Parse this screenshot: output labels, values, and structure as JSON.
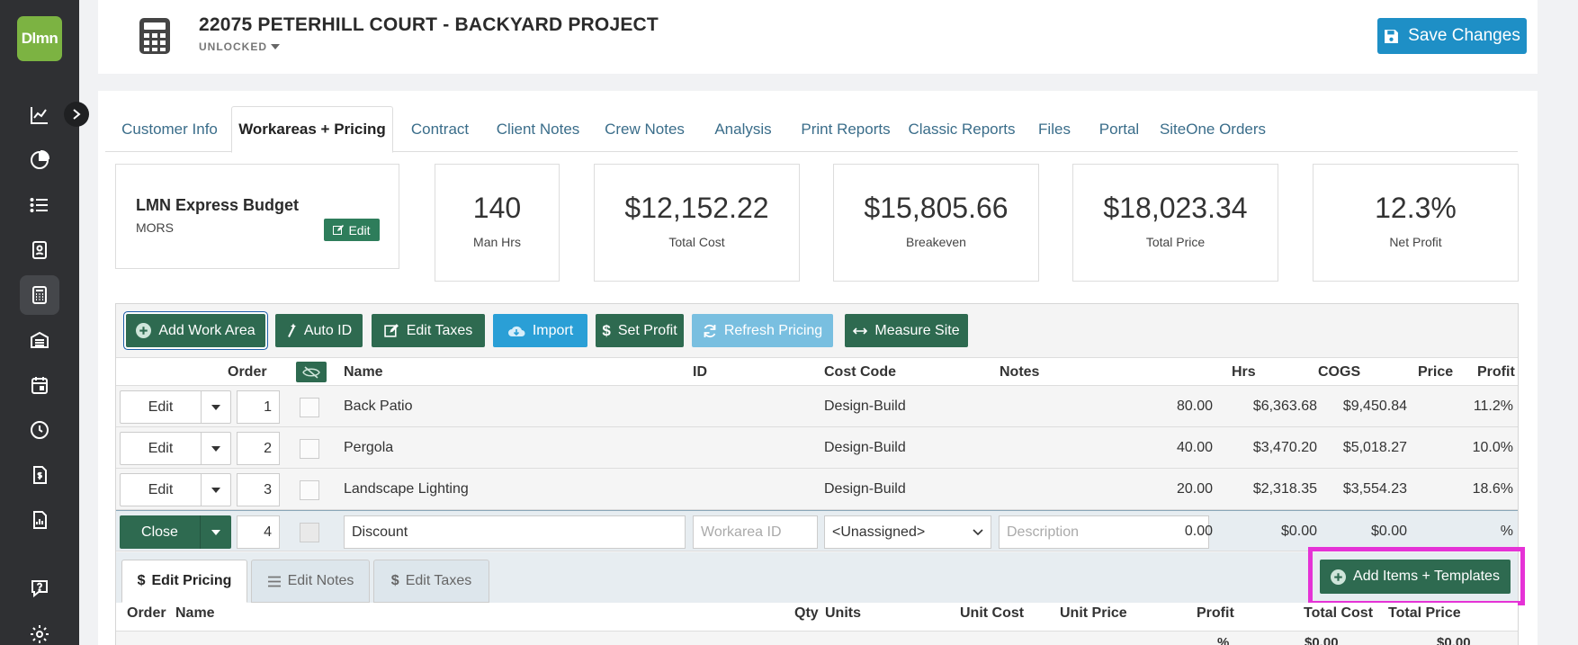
{
  "app": {
    "logo_text": "Dlmn"
  },
  "header": {
    "title": "22075 PETERHILL COURT - BACKYARD PROJECT",
    "lock_status": "UNLOCKED",
    "save_label": "Save Changes"
  },
  "tabs": [
    "Customer Info",
    "Workareas + Pricing",
    "Contract",
    "Client Notes",
    "Crew Notes",
    "Analysis",
    "Print Reports",
    "Classic Reports",
    "Files",
    "Portal",
    "SiteOne Orders"
  ],
  "budget": {
    "title": "LMN Express Budget",
    "subtitle": "MORS",
    "edit_label": "Edit"
  },
  "stats": [
    {
      "value": "140",
      "label": "Man Hrs"
    },
    {
      "value": "$12,152.22",
      "label": "Total Cost"
    },
    {
      "value": "$15,805.66",
      "label": "Breakeven"
    },
    {
      "value": "$18,023.34",
      "label": "Total Price"
    },
    {
      "value": "12.3%",
      "label": "Net Profit"
    }
  ],
  "toolbar": {
    "add_work_area": "Add Work Area",
    "auto_id": "Auto ID",
    "edit_taxes": "Edit Taxes",
    "import": "Import",
    "set_profit": "Set Profit",
    "refresh_pricing": "Refresh Pricing",
    "measure_site": "Measure Site"
  },
  "table": {
    "headers": {
      "order": "Order",
      "name": "Name",
      "id": "ID",
      "cost_code": "Cost Code",
      "notes": "Notes",
      "hrs": "Hrs",
      "cogs": "COGS",
      "price": "Price",
      "profit": "Profit"
    },
    "edit_label": "Edit",
    "close_label": "Close",
    "rows": [
      {
        "order": "1",
        "name": "Back Patio",
        "cost_code": "Design-Build",
        "hrs": "80.00",
        "cogs": "$6,363.68",
        "price": "$9,450.84",
        "profit": "11.2%"
      },
      {
        "order": "2",
        "name": "Pergola",
        "cost_code": "Design-Build",
        "hrs": "40.00",
        "cogs": "$3,470.20",
        "price": "$5,018.27",
        "profit": "10.0%"
      },
      {
        "order": "3",
        "name": "Landscape Lighting",
        "cost_code": "Design-Build",
        "hrs": "20.00",
        "cogs": "$2,318.35",
        "price": "$3,554.23",
        "profit": "18.6%"
      }
    ],
    "open_row": {
      "order": "4",
      "name_value": "Discount",
      "id_placeholder": "Workarea ID",
      "cost_code_value": "<Unassigned>",
      "notes_placeholder": "Description",
      "hrs": "0.00",
      "cogs": "$0.00",
      "price": "$0.00",
      "profit": "%"
    }
  },
  "subtabs": [
    "Edit Pricing",
    "Edit Notes",
    "Edit Taxes"
  ],
  "add_items_label": "Add Items + Templates",
  "sub_table": {
    "headers": {
      "order": "Order",
      "name": "Name",
      "qty": "Qty",
      "units": "Units",
      "unit_cost": "Unit Cost",
      "unit_price": "Unit Price",
      "profit": "Profit",
      "total_cost": "Total Cost",
      "total_price": "Total Price"
    },
    "row": {
      "profit": "%",
      "total_cost": "$0.00",
      "total_price": "$0.00"
    }
  }
}
